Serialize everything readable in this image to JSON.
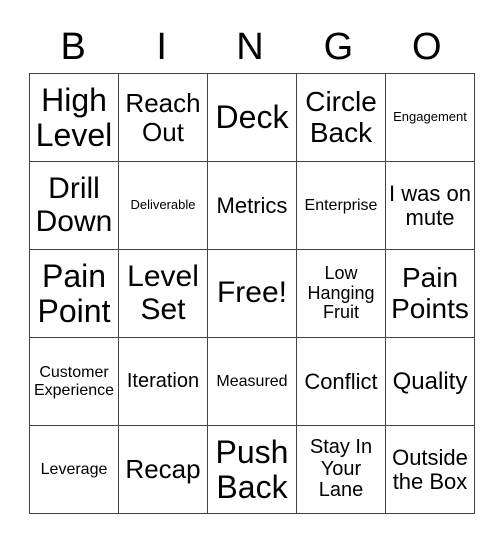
{
  "header": [
    "B",
    "I",
    "N",
    "G",
    "O"
  ],
  "cells": [
    [
      "High Level",
      "Reach Out",
      "Deck",
      "Circle Back",
      "Engagement"
    ],
    [
      "Drill Down",
      "Deliverable",
      "Metrics",
      "Enterprise",
      "I was on mute"
    ],
    [
      "Pain Point",
      "Level Set",
      "Free!",
      "Low Hanging Fruit",
      "Pain Points"
    ],
    [
      "Customer Experience",
      "Iteration",
      "Measured",
      "Conflict",
      "Quality"
    ],
    [
      "Leverage",
      "Recap",
      "Push Back",
      "Stay In Your Lane",
      "Outside the Box"
    ]
  ]
}
